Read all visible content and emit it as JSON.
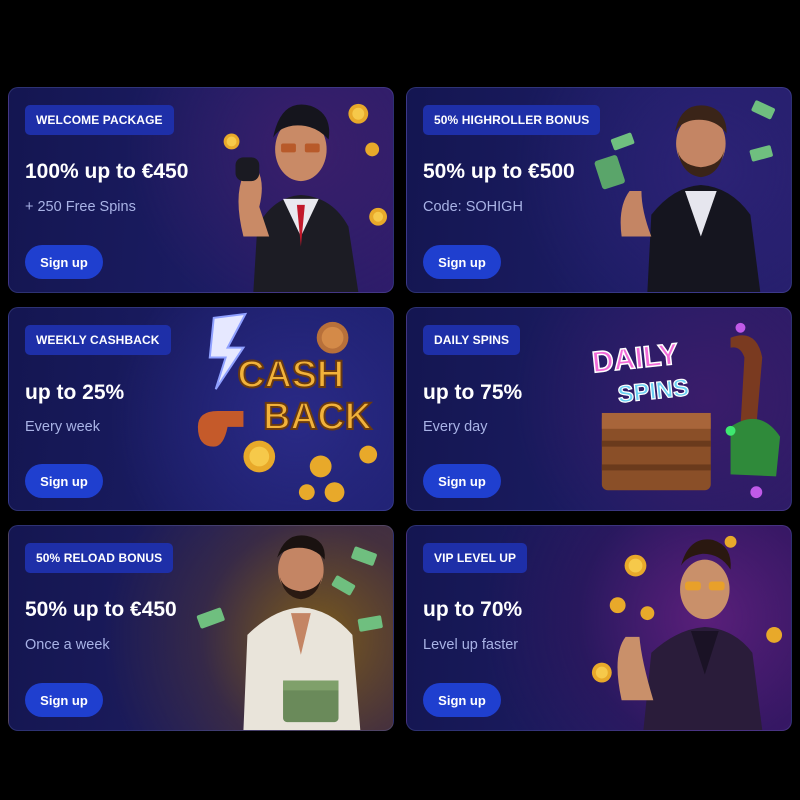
{
  "promos": [
    {
      "badge": "WELCOME PACKAGE",
      "headline": "100% up to €450",
      "sub": "+ 250 Free Spins",
      "button": "Sign up",
      "illustration": "mafia-man-with-coins-icon"
    },
    {
      "badge": "50% HIGHROLLER BONUS",
      "headline": "50% up to €500",
      "sub": "Code: SOHIGH",
      "button": "Sign up",
      "illustration": "man-with-cash-icon"
    },
    {
      "badge": "WEEKLY CASHBACK",
      "headline": "up to 25%",
      "sub": "Every week",
      "button": "Sign up",
      "illustration": "cashback-text-icon",
      "art_text": [
        "CASH",
        "BACK"
      ]
    },
    {
      "badge": "DAILY SPINS",
      "headline": "up to 75%",
      "sub": "Every day",
      "button": "Sign up",
      "illustration": "daily-spins-chest-icon",
      "art_text": [
        "DAILY",
        "SPINS"
      ]
    },
    {
      "badge": "50% RELOAD BONUS",
      "headline": "50% up to €450",
      "sub": "Once a week",
      "button": "Sign up",
      "illustration": "man-with-money-stack-icon"
    },
    {
      "badge": "VIP LEVEL UP",
      "headline": "up to 70%",
      "sub": "Level up faster",
      "button": "Sign up",
      "illustration": "vip-man-with-coins-icon"
    }
  ],
  "colors": {
    "page_background": "#000000",
    "card_background": "#1b1c63",
    "badge_background": "#1e2fa8",
    "button_background": "#1f3fcf",
    "subtext": "#a9b3e6",
    "coin_gold": "#e8a92a"
  }
}
